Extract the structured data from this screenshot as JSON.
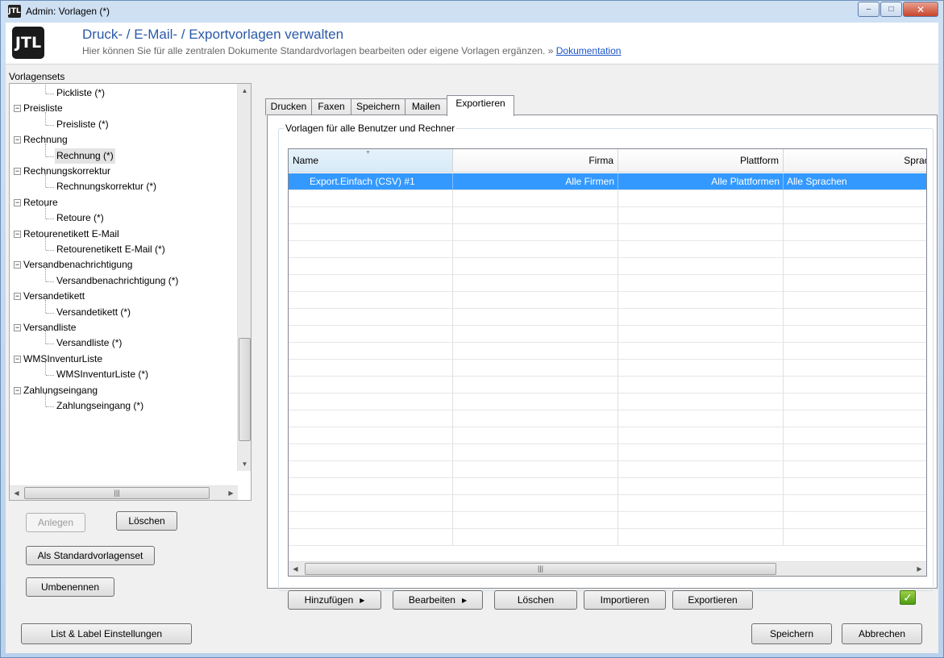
{
  "window": {
    "title": "Admin: Vorlagen (*)",
    "icon_label": "JTL",
    "controls": {
      "minimize": "–",
      "maximize": "□",
      "close": "✕"
    }
  },
  "header": {
    "logo": "JTL",
    "title": "Druck- / E-Mail- / Exportvorlagen verwalten",
    "subtitle": "Hier können Sie für alle zentralen Dokumente Standardvorlagen bearbeiten oder eigene Vorlagen ergänzen. » ",
    "doc_link": "Dokumentation"
  },
  "vorlagensets": {
    "title": "Vorlagensets",
    "tree": [
      {
        "label": "Pickliste (*)",
        "level": 1
      },
      {
        "label": "Preisliste",
        "level": 0
      },
      {
        "label": "Preisliste (*)",
        "level": 1
      },
      {
        "label": "Rechnung",
        "level": 0
      },
      {
        "label": "Rechnung (*)",
        "level": 1,
        "selected": true
      },
      {
        "label": "Rechnungskorrektur",
        "level": 0
      },
      {
        "label": "Rechnungskorrektur (*)",
        "level": 1
      },
      {
        "label": "Retoure",
        "level": 0
      },
      {
        "label": "Retoure (*)",
        "level": 1
      },
      {
        "label": "Retourenetikett E-Mail",
        "level": 0
      },
      {
        "label": "Retourenetikett E-Mail (*)",
        "level": 1
      },
      {
        "label": "Versandbenachrichtigung",
        "level": 0
      },
      {
        "label": "Versandbenachrichtigung (*)",
        "level": 1
      },
      {
        "label": "Versandetikett",
        "level": 0
      },
      {
        "label": "Versandetikett (*)",
        "level": 1
      },
      {
        "label": "Versandliste",
        "level": 0
      },
      {
        "label": "Versandliste (*)",
        "level": 1
      },
      {
        "label": "WMSInventurListe",
        "level": 0
      },
      {
        "label": "WMSInventurListe (*)",
        "level": 1
      },
      {
        "label": "Zahlungseingang",
        "level": 0
      },
      {
        "label": "Zahlungseingang (*)",
        "level": 1
      }
    ],
    "buttons": {
      "anlegen": "Anlegen",
      "loeschen": "Löschen",
      "standard": "Als Standardvorlagenset",
      "umbenennen": "Umbenennen"
    }
  },
  "tabs": [
    {
      "label": "Drucken",
      "active": false
    },
    {
      "label": "Faxen",
      "active": false
    },
    {
      "label": "Speichern",
      "active": false
    },
    {
      "label": "Mailen",
      "active": false
    },
    {
      "label": "Exportieren",
      "active": true
    }
  ],
  "templates": {
    "group_title": "Vorlagen für alle Benutzer und Rechner",
    "columns": [
      "Name",
      "Firma",
      "Plattform",
      "Sprache"
    ],
    "rows": [
      {
        "name": "Export.Einfach (CSV) #1",
        "firma": "Alle Firmen",
        "plattform": "Alle Plattformen",
        "sprache": "Alle Sprachen",
        "selected": true
      }
    ],
    "buttons": {
      "hinzufuegen": "Hinzufügen",
      "bearbeiten": "Bearbeiten",
      "loeschen": "Löschen",
      "importieren": "Importieren",
      "exportieren": "Exportieren"
    }
  },
  "footer": {
    "list_label": "List & Label Einstellungen",
    "speichern": "Speichern",
    "abbrechen": "Abbrechen"
  },
  "colors": {
    "selection": "#3399ff",
    "header_title": "#2a5aa8",
    "link": "#1b54c8"
  }
}
